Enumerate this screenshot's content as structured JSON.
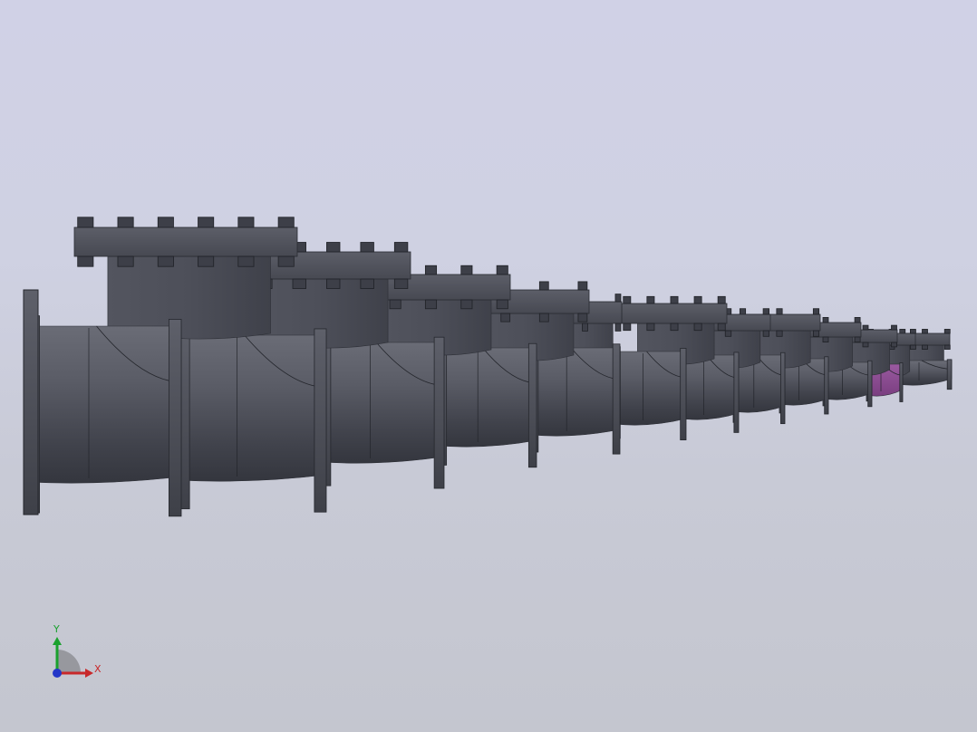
{
  "viewport": {
    "background_top": "#d0d1e6",
    "background_bottom": "#c4c6cf"
  },
  "model": {
    "name": "valve-assembly-array",
    "valve_count": 12,
    "body_color": "#4c4e58",
    "highlight_color": "#8a4b8e"
  },
  "triad": {
    "y_label": "Y",
    "x_label": "X",
    "y_color": "#1aa12e",
    "x_color": "#c8282a",
    "z_color": "#2336c8"
  }
}
